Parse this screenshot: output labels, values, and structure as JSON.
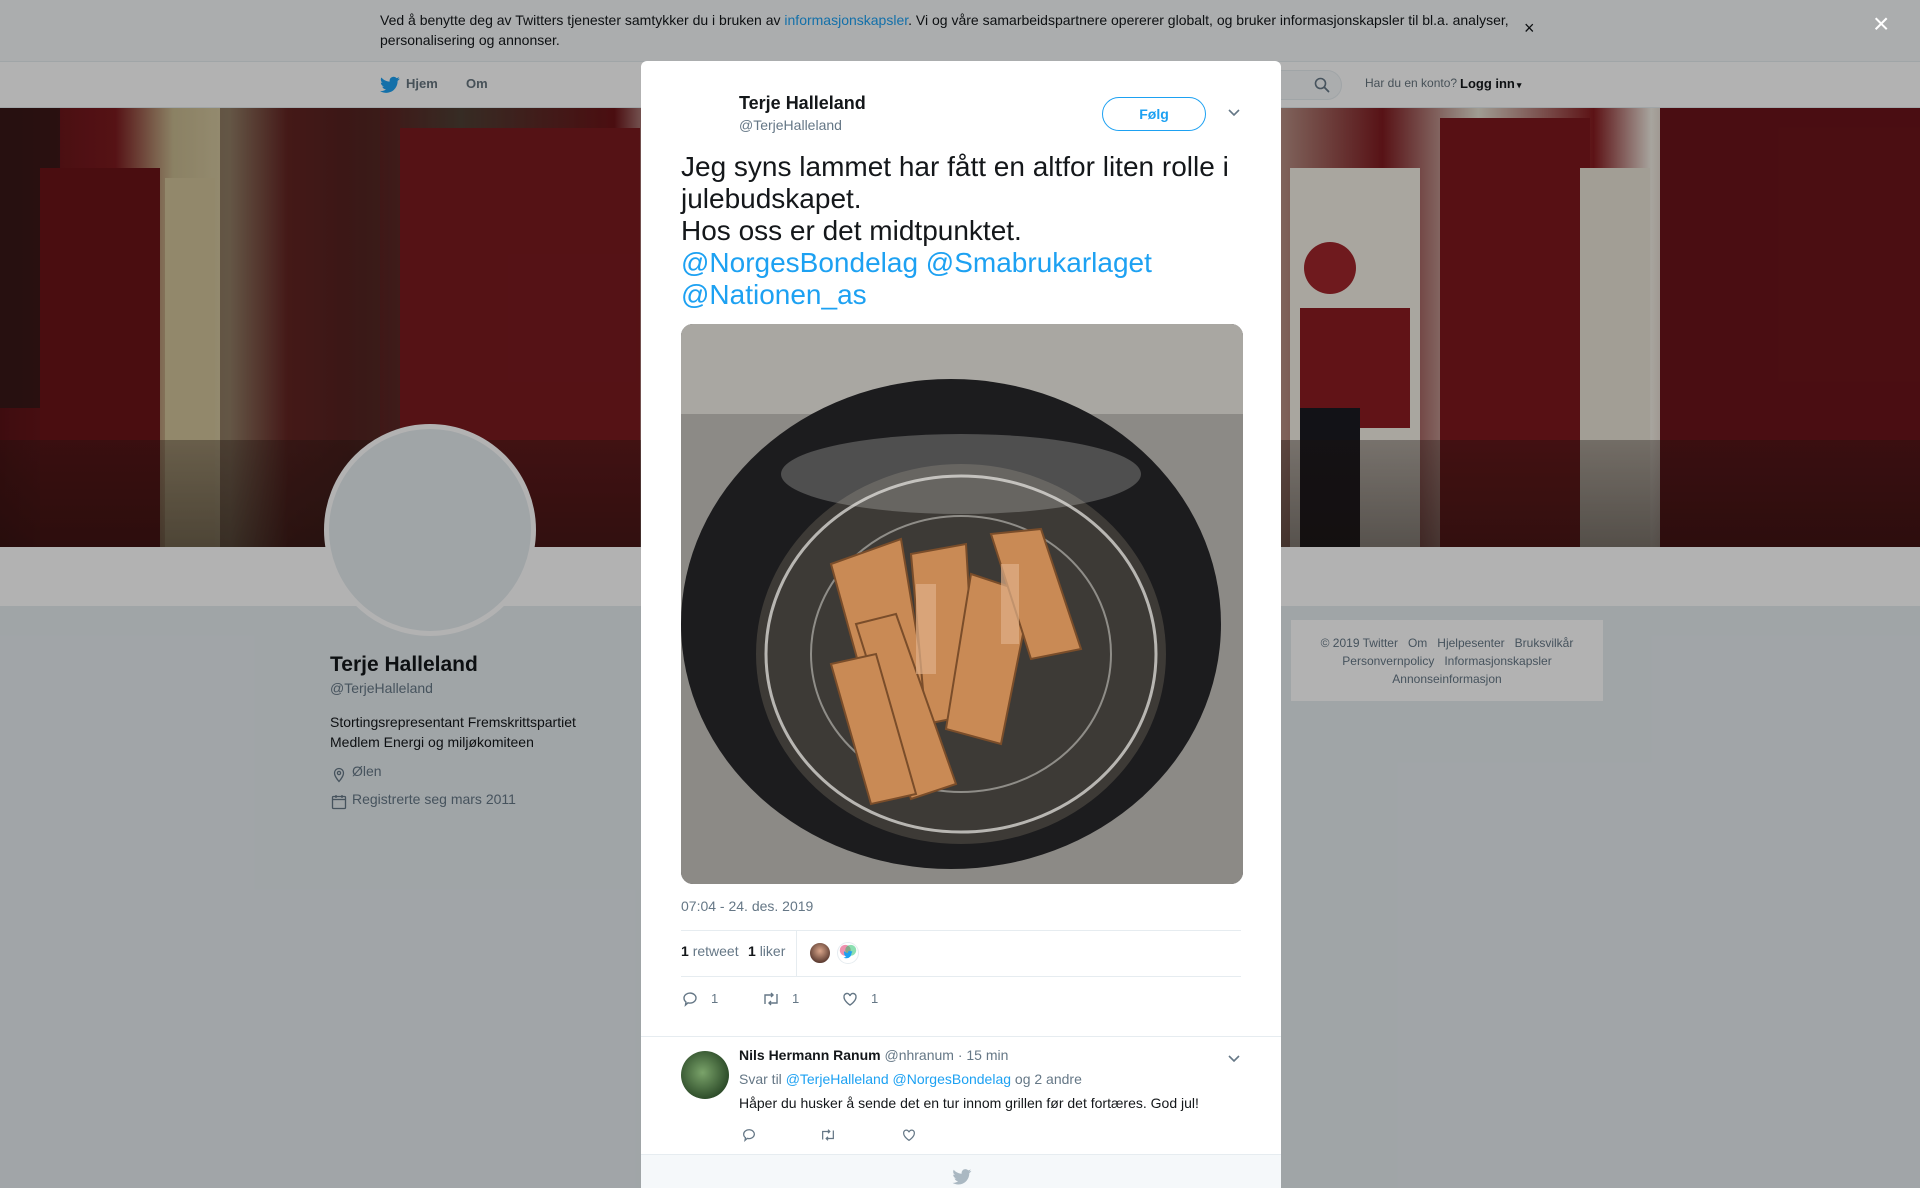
{
  "cookie_banner": {
    "text_before": "Ved å benytte deg av Twitters tjenester samtykker du i bruken av ",
    "link": "informasjonskapsler",
    "text_after": ". Vi og våre samarbeidspartnere opererer globalt, og bruker informasjonskapsler til bl.a. analyser, personalisering og annonser.",
    "close": "×"
  },
  "nav": {
    "home": "Hjem",
    "about": "Om",
    "login_prompt": "Har du en konto?",
    "login": "Logg inn"
  },
  "profile": {
    "name": "Terje Halleland",
    "handle": "@TerjeHalleland",
    "bio_line1": "Stortingsrepresentant Fremskrittspartiet",
    "bio_line2": "Medlem Energi og miljøkomiteen",
    "location": "Ølen",
    "joined": "Registrerte seg mars 2011"
  },
  "footer": {
    "copyright": "© 2019 Twitter",
    "about": "Om",
    "help": "Hjelpesenter",
    "terms": "Bruksvilkår",
    "privacy": "Personvernpolicy",
    "cookies": "Informasjonskapsler",
    "ads": "Annonseinformasjon"
  },
  "overlay": {
    "close": "×"
  },
  "tweet": {
    "author_name": "Terje Halleland",
    "author_handle": "@TerjeHalleland",
    "follow_label": "Følg",
    "text_line1": "Jeg syns lammet har fått en altfor liten rolle i julebudskapet.",
    "text_line2": "Hos oss er det midtpunktet.",
    "mention1": "@NorgesBondelag",
    "mention2": "@Smabrukarlaget",
    "mention3": "@Nationen_as",
    "timestamp": "07:04 - 24. des. 2019",
    "retweet_count": "1",
    "retweet_label": "retweet",
    "like_count": "1",
    "like_label": "liker",
    "action_reply_count": "1",
    "action_retweet_count": "1",
    "action_like_count": "1"
  },
  "reply": {
    "name": "Nils Hermann Ranum",
    "handle": "@nhranum",
    "time": "· 15 min",
    "reply_to_prefix": "Svar til",
    "reply_to_1": "@TerjeHalleland",
    "reply_to_2": "@NorgesBondelag",
    "reply_to_suffix": "og 2 andre",
    "text": "Håper du husker å sende det en tur innom grillen før det fortæres. God jul!"
  },
  "colors": {
    "accent": "#1da1f2",
    "text": "#14171a",
    "muted": "#657786"
  }
}
